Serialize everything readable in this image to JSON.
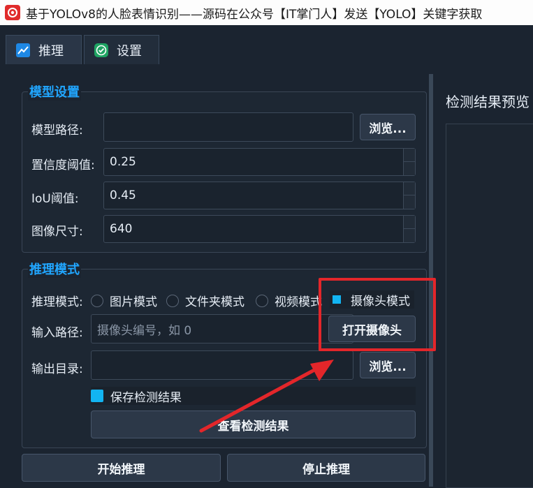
{
  "window": {
    "title": "基于YOLOv8的人脸表情识别——源码在公众号【IT掌门人】发送【YOLO】关键字获取",
    "icon": "red-eye-logo-icon"
  },
  "tabs": [
    {
      "label": "推理",
      "icon": "chart-line-icon",
      "active": true
    },
    {
      "label": "设置",
      "icon": "check-circle-icon",
      "active": false
    }
  ],
  "model_settings": {
    "title": "模型设置",
    "model_path_label": "模型路径:",
    "model_path_value": "",
    "browse_label": "浏览...",
    "confidence_label": "置信度阈值:",
    "confidence_value": "0.25",
    "iou_label": "IoU阈值:",
    "iou_value": "0.45",
    "image_size_label": "图像尺寸:",
    "image_size_value": "640"
  },
  "inference_mode": {
    "title": "推理模式",
    "mode_label": "推理模式:",
    "options": [
      "图片模式",
      "文件夹模式",
      "视频模式",
      "摄像头模式"
    ],
    "selected": "摄像头模式",
    "input_path_label": "输入路径:",
    "input_path_placeholder": "摄像头编号，如 0",
    "open_camera_label": "打开摄像头",
    "output_dir_label": "输出目录:",
    "output_dir_value": "",
    "output_browse_label": "浏览...",
    "save_results_label": "保存检测结果",
    "save_results_checked": true,
    "view_results_label": "查看检测结果"
  },
  "actions": {
    "start_label": "开始推理",
    "stop_label": "停止推理"
  },
  "preview": {
    "title": "检测结果预览"
  },
  "colors": {
    "accent": "#21a6ff",
    "selected": "#12b4f2",
    "highlight_annotation": "#e3262a"
  }
}
